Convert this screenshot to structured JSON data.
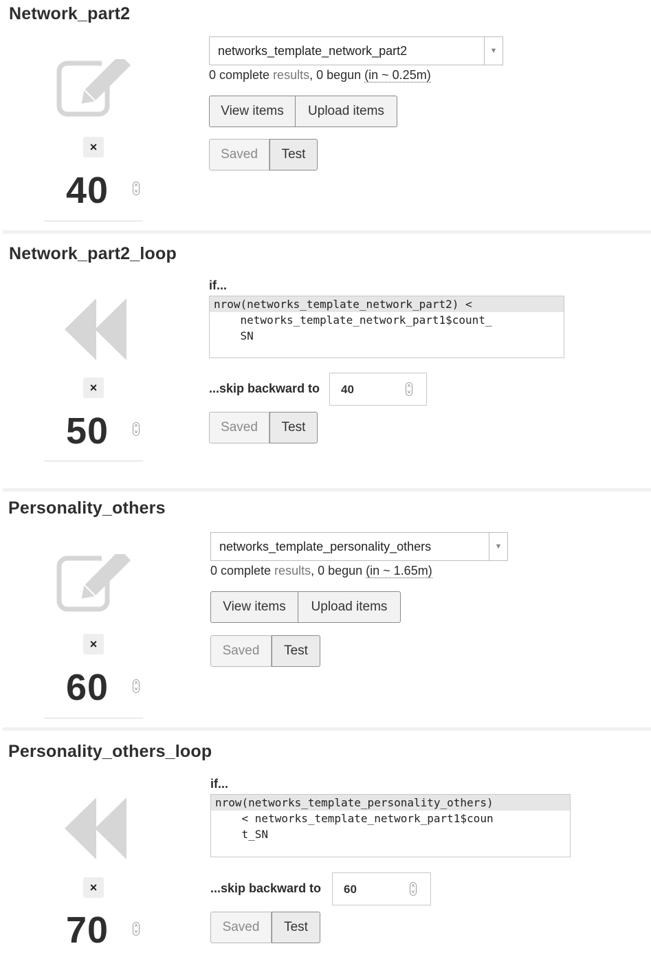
{
  "sections": [
    {
      "title": "Network_part2",
      "position": "40",
      "type": "survey",
      "icon": "edit-icon",
      "remove_label": "×",
      "survey": "networks_template_network_part2",
      "status_count": "0 complete ",
      "status_results": "results",
      "status_begun": ", 0 begun ",
      "status_estimate": "(in ~ 0.25m)",
      "view_items": "View items",
      "upload_items": "Upload items",
      "saved": "Saved",
      "test": "Test"
    },
    {
      "title": "Network_part2_loop",
      "position": "50",
      "type": "loop",
      "icon": "skip-backward-icon",
      "remove_label": "×",
      "if_label": "if...",
      "condition_lines": [
        "nrow(networks_template_network_part2) <",
        "    networks_template_network_part1$count_",
        "    SN"
      ],
      "skip_label": "...skip backward to",
      "skip_to": "40",
      "saved": "Saved",
      "test": "Test"
    },
    {
      "title": "Personality_others",
      "position": "60",
      "type": "survey",
      "icon": "edit-icon",
      "remove_label": "×",
      "survey": "networks_template_personality_others",
      "status_count": "0 complete ",
      "status_results": "results",
      "status_begun": ", 0 begun ",
      "status_estimate": "(in ~ 1.65m)",
      "view_items": "View items",
      "upload_items": "Upload items",
      "saved": "Saved",
      "test": "Test"
    },
    {
      "title": "Personality_others_loop",
      "position": "70",
      "type": "loop",
      "icon": "skip-backward-icon",
      "remove_label": "×",
      "if_label": "if...",
      "condition_lines": [
        "nrow(networks_template_personality_others)",
        "    < networks_template_network_part1$coun",
        "    t_SN"
      ],
      "skip_label": "...skip backward to",
      "skip_to": "60",
      "saved": "Saved",
      "test": "Test"
    }
  ],
  "colors": {
    "icon_gray": "#d6d6d6",
    "separator": "#f1f1f1",
    "button_border": "#8a8a8a"
  }
}
